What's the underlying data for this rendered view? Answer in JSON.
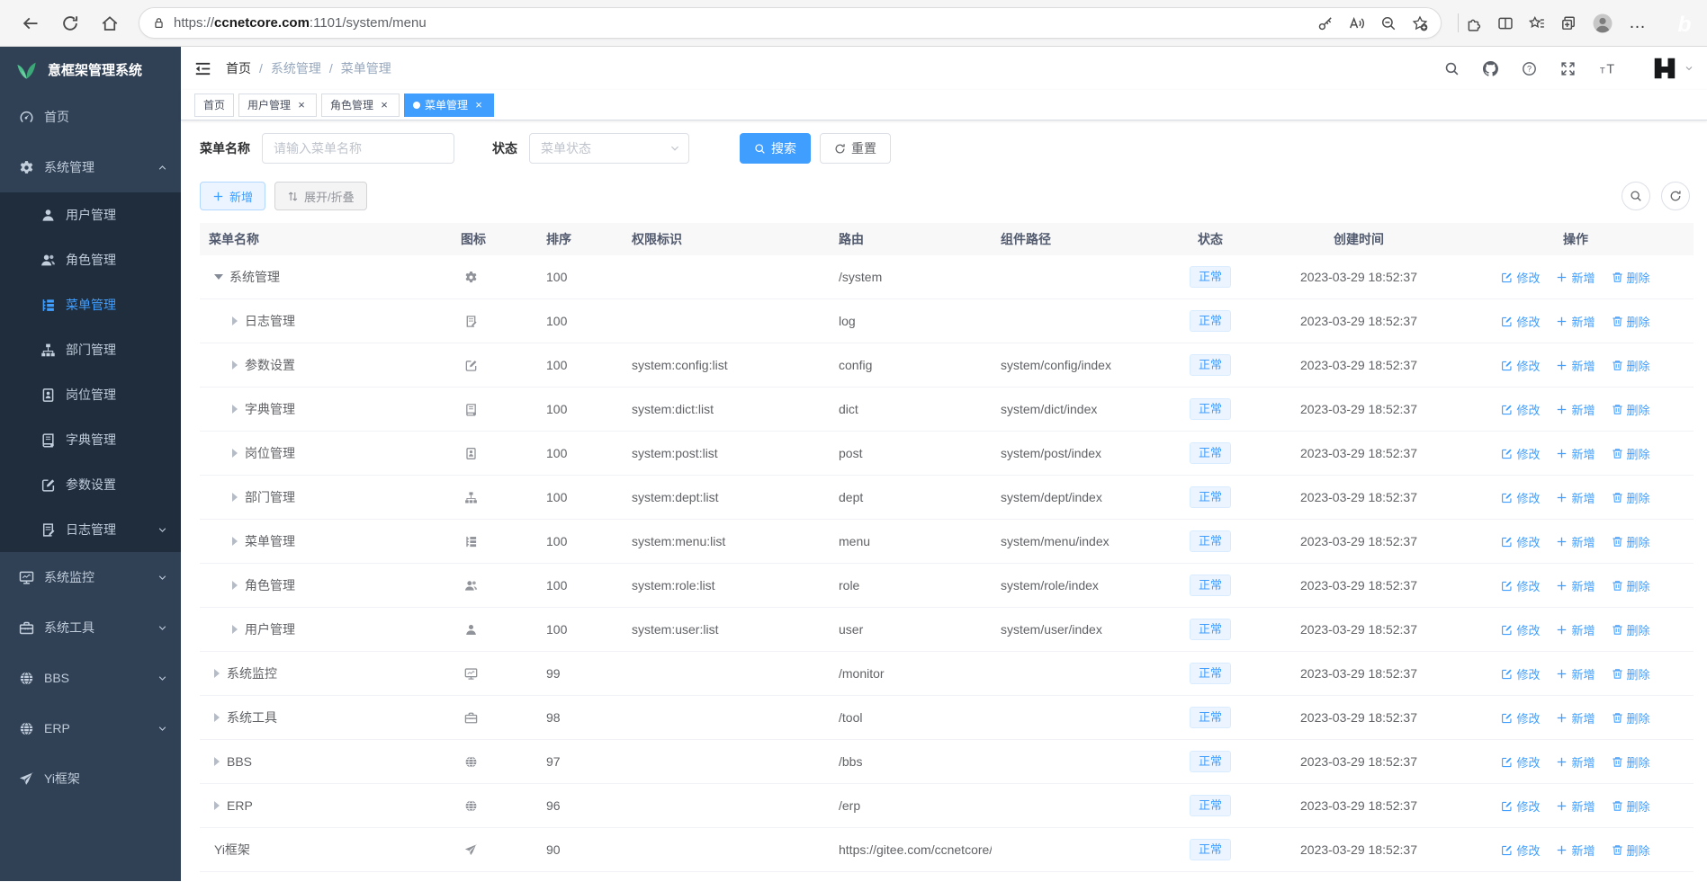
{
  "browser": {
    "url_scheme": "https://",
    "url_host": "ccnetcore.com",
    "url_path": ":1101/system/menu"
  },
  "sidebar": {
    "title": "意框架管理系统",
    "items": [
      {
        "icon": "gauge",
        "label": "首页",
        "indent": 0
      },
      {
        "icon": "gear",
        "label": "系统管理",
        "indent": 0,
        "chevron": "up"
      },
      {
        "icon": "user",
        "label": "用户管理",
        "indent": 1
      },
      {
        "icon": "users",
        "label": "角色管理",
        "indent": 1
      },
      {
        "icon": "menu",
        "label": "菜单管理",
        "indent": 1,
        "active": true
      },
      {
        "icon": "tree",
        "label": "部门管理",
        "indent": 1
      },
      {
        "icon": "badge",
        "label": "岗位管理",
        "indent": 1
      },
      {
        "icon": "book",
        "label": "字典管理",
        "indent": 1
      },
      {
        "icon": "pen",
        "label": "参数设置",
        "indent": 1
      },
      {
        "icon": "log",
        "label": "日志管理",
        "indent": 1,
        "chevron": "down"
      },
      {
        "icon": "monitor",
        "label": "系统监控",
        "indent": 0,
        "chevron": "down"
      },
      {
        "icon": "toolbox",
        "label": "系统工具",
        "indent": 0,
        "chevron": "down"
      },
      {
        "icon": "globe",
        "label": "BBS",
        "indent": 0,
        "chevron": "down"
      },
      {
        "icon": "globe",
        "label": "ERP",
        "indent": 0,
        "chevron": "down"
      },
      {
        "icon": "send",
        "label": "Yi框架",
        "indent": 0
      }
    ]
  },
  "header": {
    "breadcrumb": [
      "首页",
      "系统管理",
      "菜单管理"
    ],
    "sep": "/"
  },
  "tabs": [
    {
      "label": "首页",
      "closable": false,
      "active": false
    },
    {
      "label": "用户管理",
      "closable": true,
      "active": false
    },
    {
      "label": "角色管理",
      "closable": true,
      "active": false
    },
    {
      "label": "菜单管理",
      "closable": true,
      "active": true
    }
  ],
  "filters": {
    "name_label": "菜单名称",
    "name_placeholder": "请输入菜单名称",
    "status_label": "状态",
    "status_placeholder": "菜单状态",
    "search_label": "搜索",
    "reset_label": "重置"
  },
  "toolbar": {
    "add_label": "新增",
    "toggle_label": "展开/折叠"
  },
  "table": {
    "columns": [
      "菜单名称",
      "图标",
      "排序",
      "权限标识",
      "路由",
      "组件路径",
      "状态",
      "创建时间",
      "操作"
    ],
    "ops": [
      {
        "key": "edit",
        "icon": "edit",
        "label": "修改"
      },
      {
        "key": "add",
        "icon": "plus",
        "label": "新增"
      },
      {
        "key": "delete",
        "icon": "trash",
        "label": "删除"
      }
    ],
    "rows": [
      {
        "name": "系统管理",
        "icon": "gear",
        "level": 0,
        "arrow": "expanded",
        "sort": "100",
        "perm": "",
        "route": "/system",
        "comp": "",
        "status": "正常",
        "created": "2023-03-29 18:52:37"
      },
      {
        "name": "日志管理",
        "icon": "log",
        "level": 1,
        "arrow": "collapsed",
        "sort": "100",
        "perm": "",
        "route": "log",
        "comp": "",
        "status": "正常",
        "created": "2023-03-29 18:52:37"
      },
      {
        "name": "参数设置",
        "icon": "pen",
        "level": 1,
        "arrow": "collapsed",
        "sort": "100",
        "perm": "system:config:list",
        "route": "config",
        "comp": "system/config/index",
        "status": "正常",
        "created": "2023-03-29 18:52:37"
      },
      {
        "name": "字典管理",
        "icon": "book",
        "level": 1,
        "arrow": "collapsed",
        "sort": "100",
        "perm": "system:dict:list",
        "route": "dict",
        "comp": "system/dict/index",
        "status": "正常",
        "created": "2023-03-29 18:52:37"
      },
      {
        "name": "岗位管理",
        "icon": "badge",
        "level": 1,
        "arrow": "collapsed",
        "sort": "100",
        "perm": "system:post:list",
        "route": "post",
        "comp": "system/post/index",
        "status": "正常",
        "created": "2023-03-29 18:52:37"
      },
      {
        "name": "部门管理",
        "icon": "tree",
        "level": 1,
        "arrow": "collapsed",
        "sort": "100",
        "perm": "system:dept:list",
        "route": "dept",
        "comp": "system/dept/index",
        "status": "正常",
        "created": "2023-03-29 18:52:37"
      },
      {
        "name": "菜单管理",
        "icon": "menu",
        "level": 1,
        "arrow": "collapsed",
        "sort": "100",
        "perm": "system:menu:list",
        "route": "menu",
        "comp": "system/menu/index",
        "status": "正常",
        "created": "2023-03-29 18:52:37"
      },
      {
        "name": "角色管理",
        "icon": "users",
        "level": 1,
        "arrow": "collapsed",
        "sort": "100",
        "perm": "system:role:list",
        "route": "role",
        "comp": "system/role/index",
        "status": "正常",
        "created": "2023-03-29 18:52:37"
      },
      {
        "name": "用户管理",
        "icon": "user",
        "level": 1,
        "arrow": "collapsed",
        "sort": "100",
        "perm": "system:user:list",
        "route": "user",
        "comp": "system/user/index",
        "status": "正常",
        "created": "2023-03-29 18:52:37"
      },
      {
        "name": "系统监控",
        "icon": "monitor",
        "level": 0,
        "arrow": "collapsed",
        "sort": "99",
        "perm": "",
        "route": "/monitor",
        "comp": "",
        "status": "正常",
        "created": "2023-03-29 18:52:37"
      },
      {
        "name": "系统工具",
        "icon": "toolbox",
        "level": 0,
        "arrow": "collapsed",
        "sort": "98",
        "perm": "",
        "route": "/tool",
        "comp": "",
        "status": "正常",
        "created": "2023-03-29 18:52:37"
      },
      {
        "name": "BBS",
        "icon": "globe",
        "level": 0,
        "arrow": "collapsed",
        "sort": "97",
        "perm": "",
        "route": "/bbs",
        "comp": "",
        "status": "正常",
        "created": "2023-03-29 18:52:37"
      },
      {
        "name": "ERP",
        "icon": "globe",
        "level": 0,
        "arrow": "collapsed",
        "sort": "96",
        "perm": "",
        "route": "/erp",
        "comp": "",
        "status": "正常",
        "created": "2023-03-29 18:52:37"
      },
      {
        "name": "Yi框架",
        "icon": "send",
        "level": 0,
        "arrow": null,
        "sort": "90",
        "perm": "",
        "route": "https://gitee.com/ccnetcore/yi",
        "comp": "",
        "status": "正常",
        "created": "2023-03-29 18:52:37"
      }
    ]
  },
  "colors": {
    "accent": "#409eff",
    "sidebar_bg": "#304156",
    "submenu_bg": "#1f2d3d",
    "sidebar_text": "#bfcbd9",
    "badge_bg": "#ecf5ff",
    "badge_border": "#d9ecff",
    "logo_green": "#43b883",
    "header_text": "#515a6e"
  }
}
